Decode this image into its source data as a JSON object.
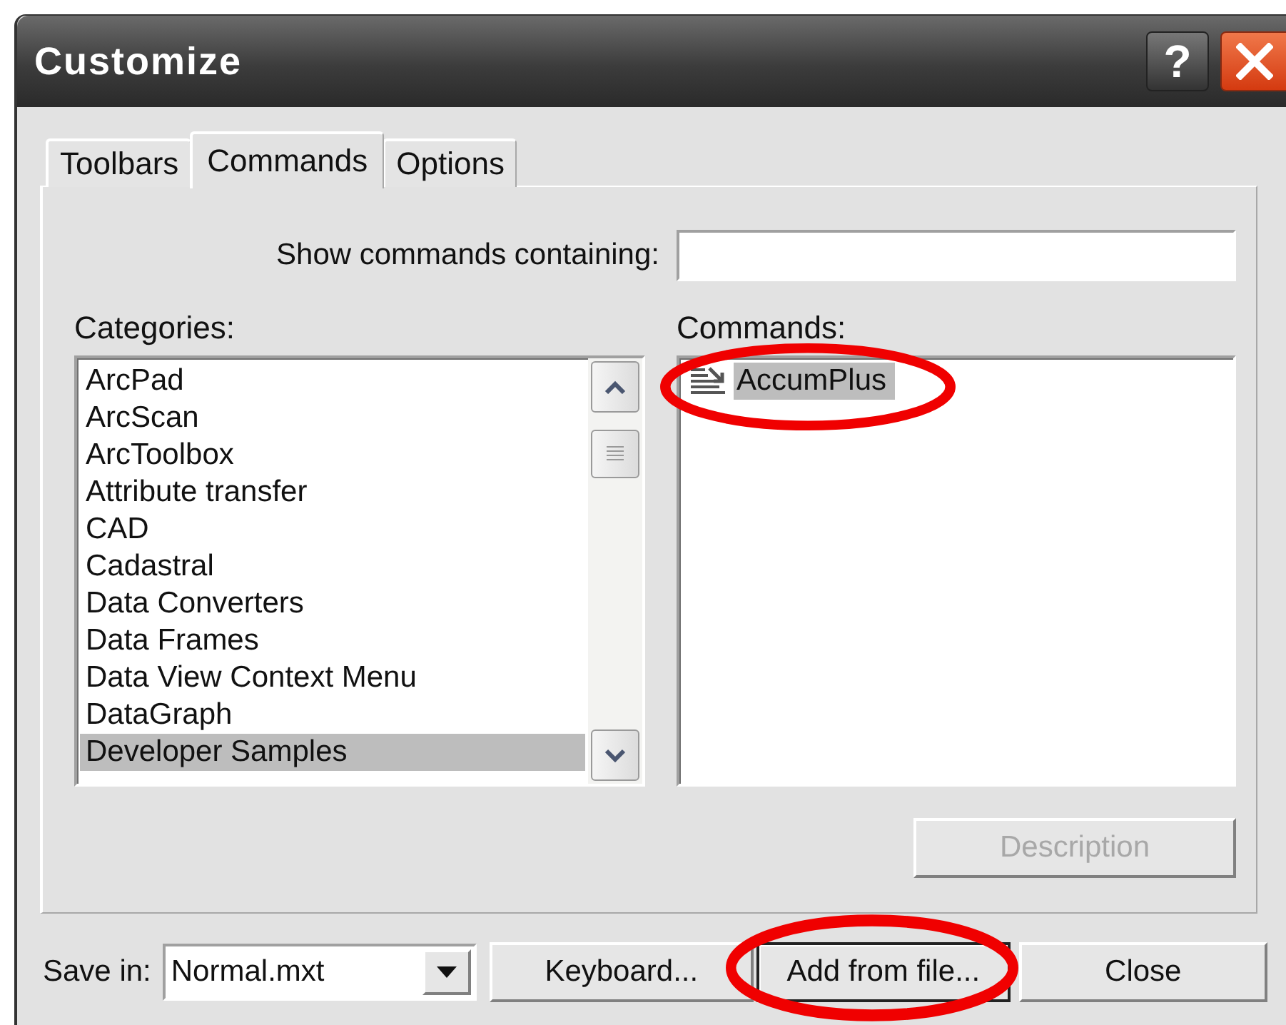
{
  "window": {
    "title": "Customize",
    "help_button": "?"
  },
  "tabs": [
    {
      "label": "Toolbars",
      "selected": false
    },
    {
      "label": "Commands",
      "selected": true
    },
    {
      "label": "Options",
      "selected": false
    }
  ],
  "search": {
    "label": "Show commands containing:"
  },
  "categories": {
    "label": "Categories:",
    "items": [
      {
        "label": "ArcPad",
        "selected": false
      },
      {
        "label": "ArcScan",
        "selected": false
      },
      {
        "label": "ArcToolbox",
        "selected": false
      },
      {
        "label": "Attribute transfer",
        "selected": false
      },
      {
        "label": "CAD",
        "selected": false
      },
      {
        "label": "Cadastral",
        "selected": false
      },
      {
        "label": "Data Converters",
        "selected": false
      },
      {
        "label": "Data Frames",
        "selected": false
      },
      {
        "label": "Data View Context Menu",
        "selected": false
      },
      {
        "label": "DataGraph",
        "selected": false
      },
      {
        "label": "Developer Samples",
        "selected": true
      }
    ]
  },
  "commands": {
    "label": "Commands:",
    "items": [
      {
        "label": "AccumPlus",
        "selected": true,
        "circled": true
      }
    ]
  },
  "description_button": {
    "label": "Description",
    "disabled": true
  },
  "save_in": {
    "label": "Save in:",
    "value": "Normal.mxt"
  },
  "buttons": [
    {
      "label": "Keyboard...",
      "focused": false,
      "circled": false
    },
    {
      "label": "Add from file...",
      "focused": true,
      "circled": true
    },
    {
      "label": "Close",
      "focused": false,
      "circled": false
    }
  ]
}
